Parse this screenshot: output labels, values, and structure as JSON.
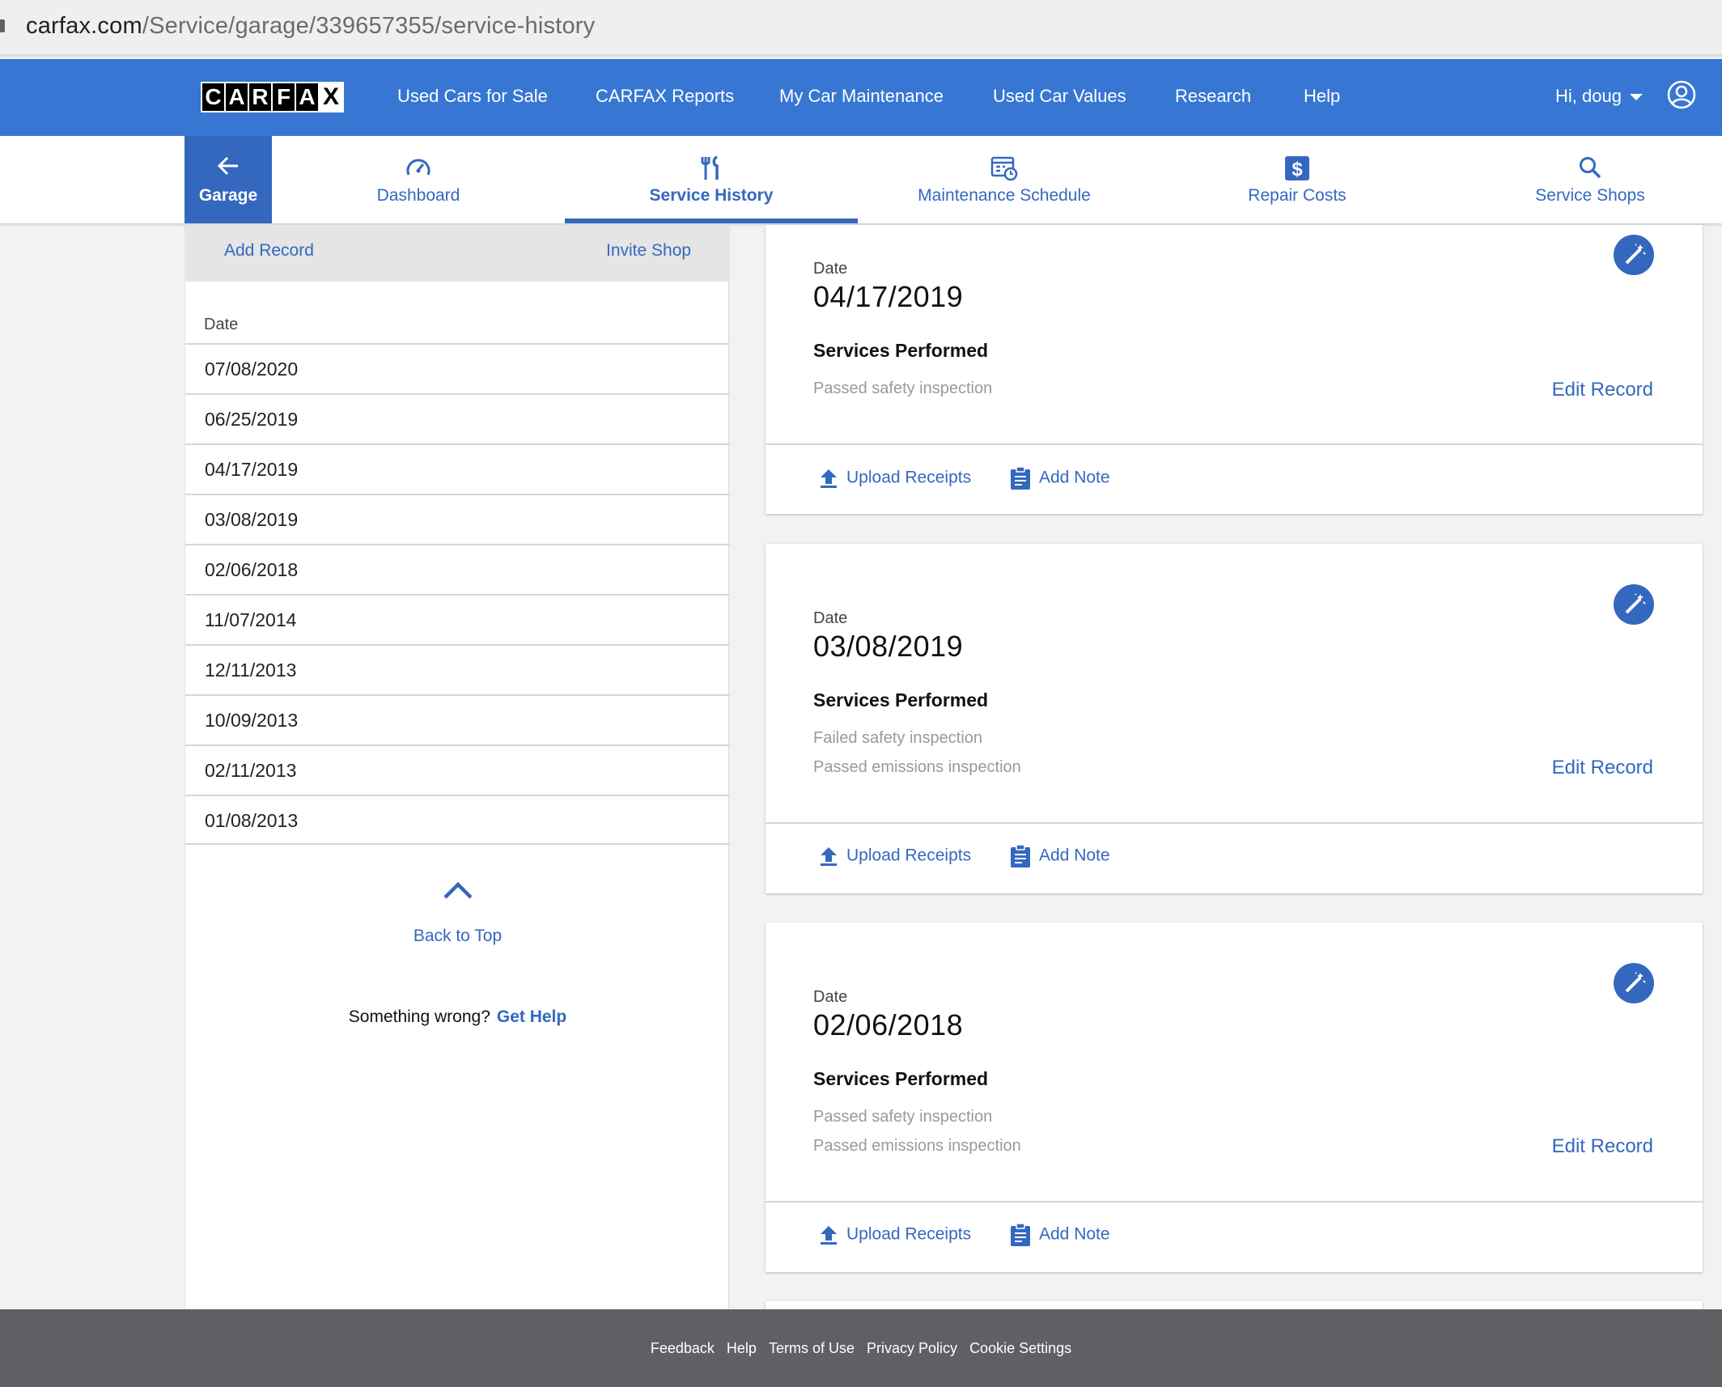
{
  "browser": {
    "url_domain": "carfax.com",
    "url_path": "/Service/garage/339657355/service-history"
  },
  "brand": {
    "logo_letters": [
      "C",
      "A",
      "R",
      "F",
      "A",
      "X"
    ]
  },
  "topnav": {
    "links": [
      "Used Cars for Sale",
      "CARFAX Reports",
      "My Car Maintenance",
      "Used Car Values",
      "Research",
      "Help"
    ],
    "user_greeting": "Hi, doug"
  },
  "subnav": {
    "back_label": "Garage",
    "tabs": [
      {
        "label": "Dashboard",
        "icon": "speedometer-icon"
      },
      {
        "label": "Service History",
        "icon": "tools-icon",
        "active": true
      },
      {
        "label": "Maintenance Schedule",
        "icon": "calendar-clock-icon"
      },
      {
        "label": "Repair Costs",
        "icon": "dollar-icon"
      },
      {
        "label": "Service Shops",
        "icon": "search-icon"
      }
    ]
  },
  "sidebar": {
    "add_record": "Add Record",
    "invite_shop": "Invite Shop",
    "date_header": "Date",
    "dates": [
      "07/08/2020",
      "06/25/2019",
      "04/17/2019",
      "03/08/2019",
      "02/06/2018",
      "11/07/2014",
      "12/11/2013",
      "10/09/2013",
      "02/11/2013",
      "01/08/2013"
    ],
    "back_to_top": "Back to Top",
    "something_wrong": "Something wrong?",
    "get_help": "Get Help"
  },
  "records": [
    {
      "date_label": "Date",
      "date": "04/17/2019",
      "services_title": "Services Performed",
      "services": [
        "Passed safety inspection"
      ],
      "edit_label": "Edit Record",
      "upload_label": "Upload Receipts",
      "note_label": "Add Note"
    },
    {
      "date_label": "Date",
      "date": "03/08/2019",
      "services_title": "Services Performed",
      "services": [
        "Failed safety inspection",
        "Passed emissions inspection"
      ],
      "edit_label": "Edit Record",
      "upload_label": "Upload Receipts",
      "note_label": "Add Note"
    },
    {
      "date_label": "Date",
      "date": "02/06/2018",
      "services_title": "Services Performed",
      "services": [
        "Passed safety inspection",
        "Passed emissions inspection"
      ],
      "edit_label": "Edit Record",
      "upload_label": "Upload Receipts",
      "note_label": "Add Note"
    }
  ],
  "footer": {
    "links": [
      "Feedback",
      "Help",
      "Terms of Use",
      "Privacy Policy",
      "Cookie Settings"
    ]
  },
  "colors": {
    "brand_blue": "#3777d3",
    "accent_blue": "#3468bf",
    "footer_gray": "#5f6063"
  }
}
